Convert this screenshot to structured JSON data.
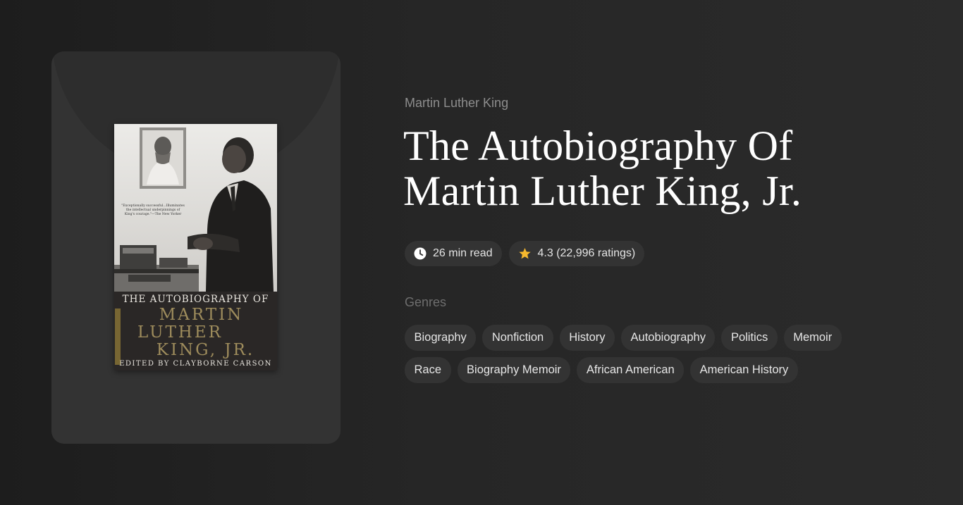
{
  "book": {
    "author": "Martin Luther King",
    "title_line1": "The Autobiography Of",
    "title_line2": "Martin Luther King, Jr.",
    "cover": {
      "quote": "\"Exceptionally successful...Illuminates the intellectual underpinnings of King's courage.\"—The New Yorker",
      "band_top": "THE AUTOBIOGRAPHY OF",
      "band_line1": "MARTIN",
      "band_line2": "LUTHER",
      "band_line3": "KING, JR.",
      "band_bottom": "EDITED BY CLAYBORNE CARSON"
    }
  },
  "meta": {
    "read_time": "26 min read",
    "rating": "4.3 (22,996 ratings)",
    "star_color": "#f5b82e",
    "clock_icon": "clock-icon",
    "star_icon": "star-icon"
  },
  "genres": {
    "heading": "Genres",
    "items": [
      "Biography",
      "Nonfiction",
      "History",
      "Autobiography",
      "Politics",
      "Memoir",
      "Race",
      "Biography Memoir",
      "African American",
      "American History"
    ]
  }
}
